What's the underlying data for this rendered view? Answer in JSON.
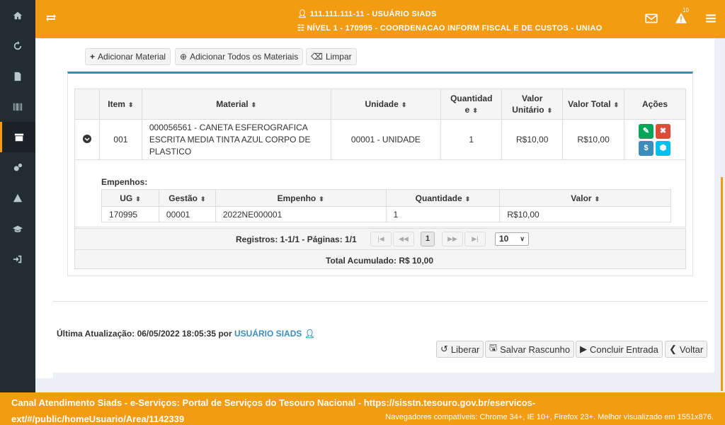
{
  "header": {
    "user_line": "111.111.111-11 - USUÁRIO SIADS",
    "level_line": "NÍVEL 1 - 170995 - COORDENACAO INFORM FISCAL E DE CUSTOS - UNIAO",
    "alerts_count": "10"
  },
  "sidebar": {
    "items": [
      "home-icon",
      "refresh-icon",
      "document-icon",
      "barcode-icon",
      "archive-icon",
      "gears-icon",
      "warning-icon",
      "graduation-icon",
      "sign-in-icon"
    ]
  },
  "toolbar": {
    "add_material": "Adicionar Material",
    "add_all": "Adicionar Todos os Materiais",
    "clear": "Limpar"
  },
  "table": {
    "headers": {
      "item": "Item",
      "material": "Material",
      "unidade": "Unidade",
      "quantidade_1": "Quantidad",
      "quantidade_2": "e",
      "valor_unit_1": "Valor",
      "valor_unit_2": "Unitário",
      "valor_total": "Valor Total",
      "acoes": "Ações"
    },
    "rows": [
      {
        "item": "001",
        "material": "000056561 - CANETA ESFEROGRAFICA ESCRITA MEDIA TINTA AZUL CORPO DE PLASTICO",
        "unidade": "00001 - UNIDADE",
        "quantidade": "1",
        "valor_unitario": "R$10,00",
        "valor_total": "R$10,00"
      }
    ]
  },
  "empenhos": {
    "label": "Empenhos:",
    "headers": {
      "ug": "UG",
      "gestao": "Gestão",
      "empenho": "Empenho",
      "quantidade": "Quantidade",
      "valor": "Valor"
    },
    "rows": [
      {
        "ug": "170995",
        "gestao": "00001",
        "empenho": "2022NE000001",
        "quantidade": "1",
        "valor": "R$10,00"
      }
    ]
  },
  "pager": {
    "summary": "Registros: 1-1/1 - Páginas: 1/1",
    "current_page": "1",
    "page_size": "10",
    "total": "Total Acumulado: R$ 10,00"
  },
  "update": {
    "label": "Última Atualização: 06/05/2022 18:05:35 por ",
    "user": "USUÁRIO SIADS"
  },
  "actions": {
    "liberar": "Liberar",
    "salvar": "Salvar Rascunho",
    "concluir": "Concluir Entrada",
    "voltar": "Voltar"
  },
  "footer": {
    "main": "Canal Atendimento Siads - e-Serviços: Portal de Serviços do Tesouro Nacional - https://sisstn.tesouro.gov.br/eservicos-ext/#/public/homeUsuario/Area/1142339",
    "compat": "Navegadores compatíveis: Chrome 34+, IE 10+, Firefox 23+. Melhor visualizado em 1551x876."
  },
  "colors": {
    "brand": "#f39c12",
    "sidebar": "#222d32",
    "primary": "#3c8dbc",
    "success": "#00a65a",
    "danger": "#dd4b39",
    "info": "#00c0ef"
  }
}
